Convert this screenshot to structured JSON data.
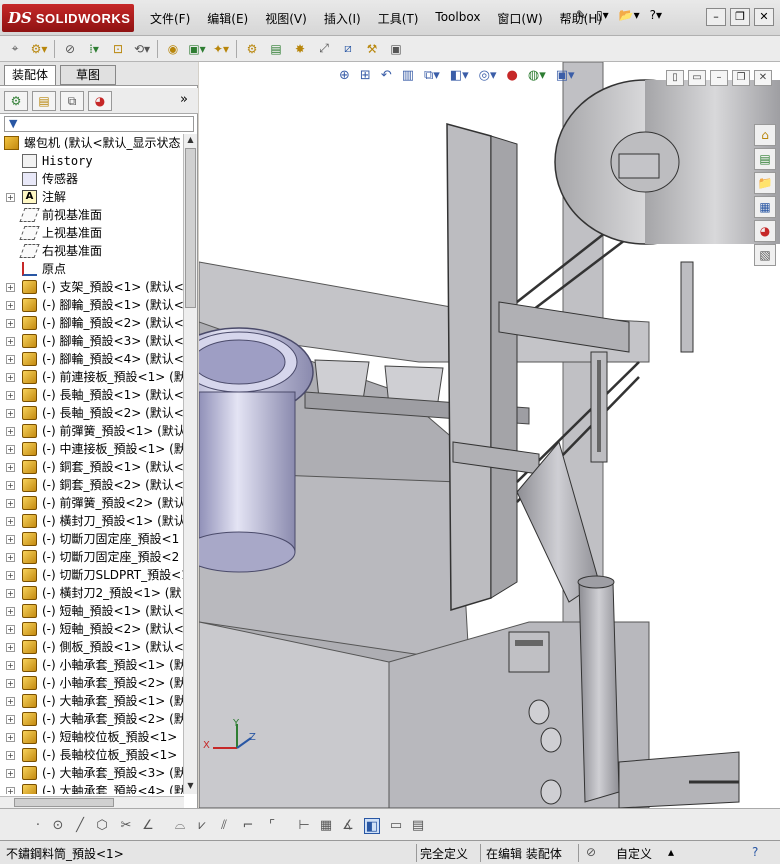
{
  "app": {
    "brand_prefix": "DS",
    "brand": "SOLIDWORKS"
  },
  "menu": [
    "文件(F)",
    "编辑(E)",
    "视图(V)",
    "插入(I)",
    "工具(T)",
    "Toolbox",
    "窗口(W)",
    "帮助(H)"
  ],
  "panel": {
    "tabs": [
      "装配体",
      "草图"
    ],
    "expand_glyph": "»",
    "tree": [
      {
        "label": "螺包机  (默认<默认_显示状态",
        "icon": "assembly",
        "level": 0,
        "expand": false
      },
      {
        "label": "History",
        "icon": "history",
        "level": 1,
        "expand": false
      },
      {
        "label": "传感器",
        "icon": "sensor",
        "level": 1,
        "expand": false
      },
      {
        "label": "注解",
        "icon": "annotation",
        "level": 1,
        "expand": true
      },
      {
        "label": "前视基准面",
        "icon": "plane",
        "level": 1,
        "expand": false
      },
      {
        "label": "上视基准面",
        "icon": "plane",
        "level": 1,
        "expand": false
      },
      {
        "label": "右视基准面",
        "icon": "plane",
        "level": 1,
        "expand": false
      },
      {
        "label": "原点",
        "icon": "origin",
        "level": 1,
        "expand": false
      },
      {
        "label": "(-) 支架_預設<1> (默认<",
        "icon": "part",
        "level": 1,
        "expand": true
      },
      {
        "label": "(-) 腳輪_預設<1> (默认<",
        "icon": "part",
        "level": 1,
        "expand": true
      },
      {
        "label": "(-) 腳輪_預設<2> (默认<",
        "icon": "part",
        "level": 1,
        "expand": true
      },
      {
        "label": "(-) 腳輪_預設<3> (默认<",
        "icon": "part",
        "level": 1,
        "expand": true
      },
      {
        "label": "(-) 腳輪_預設<4> (默认<",
        "icon": "part",
        "level": 1,
        "expand": true
      },
      {
        "label": "(-) 前連接板_預設<1> (默",
        "icon": "part",
        "level": 1,
        "expand": true
      },
      {
        "label": "(-) 長軸_預設<1> (默认<",
        "icon": "part",
        "level": 1,
        "expand": true
      },
      {
        "label": "(-) 長軸_預設<2> (默认<",
        "icon": "part",
        "level": 1,
        "expand": true
      },
      {
        "label": "(-) 前彈簧_預設<1> (默认",
        "icon": "part",
        "level": 1,
        "expand": true
      },
      {
        "label": "(-) 中連接板_預設<1> (默",
        "icon": "part",
        "level": 1,
        "expand": true
      },
      {
        "label": "(-) 銅套_預設<1> (默认<",
        "icon": "part",
        "level": 1,
        "expand": true
      },
      {
        "label": "(-) 銅套_預設<2> (默认<",
        "icon": "part",
        "level": 1,
        "expand": true
      },
      {
        "label": "(-) 前彈簧_預設<2> (默认",
        "icon": "part",
        "level": 1,
        "expand": true
      },
      {
        "label": "(-) 橫封刀_預設<1> (默认",
        "icon": "part",
        "level": 1,
        "expand": true
      },
      {
        "label": "(-) 切斷刀固定座_預設<1",
        "icon": "part",
        "level": 1,
        "expand": true
      },
      {
        "label": "(-) 切斷刀固定座_預設<2",
        "icon": "part",
        "level": 1,
        "expand": true
      },
      {
        "label": "(-) 切斷刀SLDPRT_預設<1",
        "icon": "part",
        "level": 1,
        "expand": true
      },
      {
        "label": "(-) 橫封刀2_預設<1> (默",
        "icon": "part",
        "level": 1,
        "expand": true
      },
      {
        "label": "(-) 短軸_預設<1> (默认<",
        "icon": "part",
        "level": 1,
        "expand": true
      },
      {
        "label": "(-) 短軸_預設<2> (默认<",
        "icon": "part",
        "level": 1,
        "expand": true
      },
      {
        "label": "(-) 側板_預設<1> (默认<",
        "icon": "part",
        "level": 1,
        "expand": true
      },
      {
        "label": "(-) 小軸承套_預設<1> (默",
        "icon": "part",
        "level": 1,
        "expand": true
      },
      {
        "label": "(-) 小軸承套_預設<2> (默",
        "icon": "part",
        "level": 1,
        "expand": true
      },
      {
        "label": "(-) 大軸承套_預設<1> (默",
        "icon": "part",
        "level": 1,
        "expand": true
      },
      {
        "label": "(-) 大軸承套_預設<2> (默",
        "icon": "part",
        "level": 1,
        "expand": true
      },
      {
        "label": "(-) 短軸校位板_預設<1>",
        "icon": "part",
        "level": 1,
        "expand": true
      },
      {
        "label": "(-) 長軸校位板_預設<1>",
        "icon": "part",
        "level": 1,
        "expand": true
      },
      {
        "label": "(-) 大軸承套_預設<3> (默",
        "icon": "part",
        "level": 1,
        "expand": true
      },
      {
        "label": "(-) 大軸承套_預設<4> (默",
        "icon": "part",
        "level": 1,
        "expand": true
      }
    ]
  },
  "triad": {
    "x": "X",
    "y": "Y",
    "z": "Z"
  },
  "status": {
    "selection": "不鏽鋼料筒_預設<1>",
    "definition": "完全定义",
    "editing": "在编辑 装配体",
    "units": "自定义"
  },
  "colors": {
    "brand_red": "#b71c1c",
    "part_icon": "#e0a923",
    "model_gray": "#b4b4b8",
    "model_purple": "#c8c8e0"
  }
}
